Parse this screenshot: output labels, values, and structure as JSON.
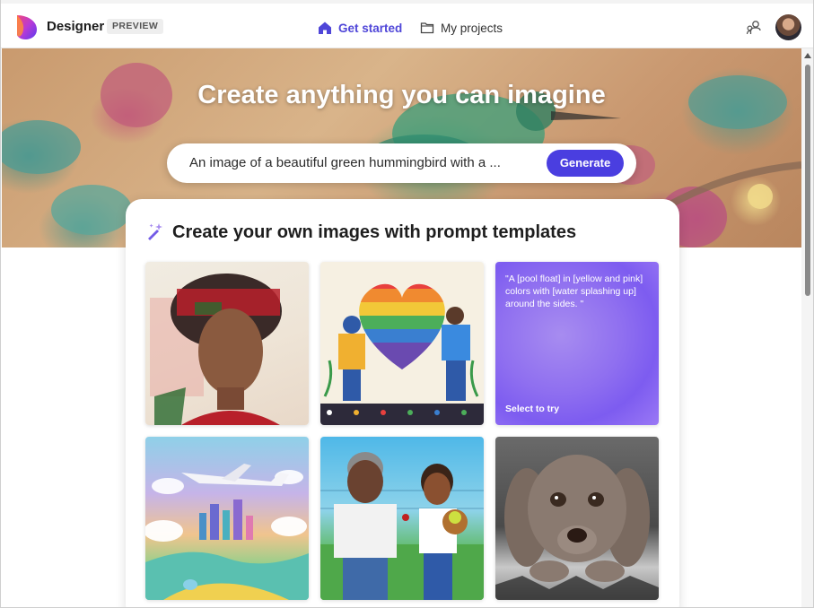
{
  "header": {
    "brand": "Designer",
    "badge": "PREVIEW",
    "nav": [
      {
        "label": "Get started",
        "icon": "home-icon",
        "active": true
      },
      {
        "label": "My projects",
        "icon": "folder-icon",
        "active": false
      }
    ],
    "share_icon": "people-link-icon",
    "avatar_icon": "profile-avatar"
  },
  "hero": {
    "title": "Create anything you can imagine",
    "prompt": "An image of a beautiful green hummingbird with a ...",
    "generate_label": "Generate"
  },
  "templates": {
    "title": "Create your own images with prompt templates",
    "icon": "sparkle-wand-icon",
    "tiles": [
      {
        "kind": "image",
        "subject": "portrait-painting"
      },
      {
        "kind": "image",
        "subject": "rainbow-heart-gardeners"
      },
      {
        "kind": "prompt",
        "prompt": "\"A [pool float] in [yellow and pink] colors with [water splashing up] around the sides. \"",
        "cta": "Select to try"
      },
      {
        "kind": "image",
        "subject": "airplane-fantasy-landscape"
      },
      {
        "kind": "image",
        "subject": "baseball-father-daughter"
      },
      {
        "kind": "image",
        "subject": "weimaraner-dog"
      }
    ]
  },
  "colors": {
    "accent": "#4a3ee0",
    "nav_active": "#4f46d8",
    "prompt_tile": "#8f6ff0"
  }
}
